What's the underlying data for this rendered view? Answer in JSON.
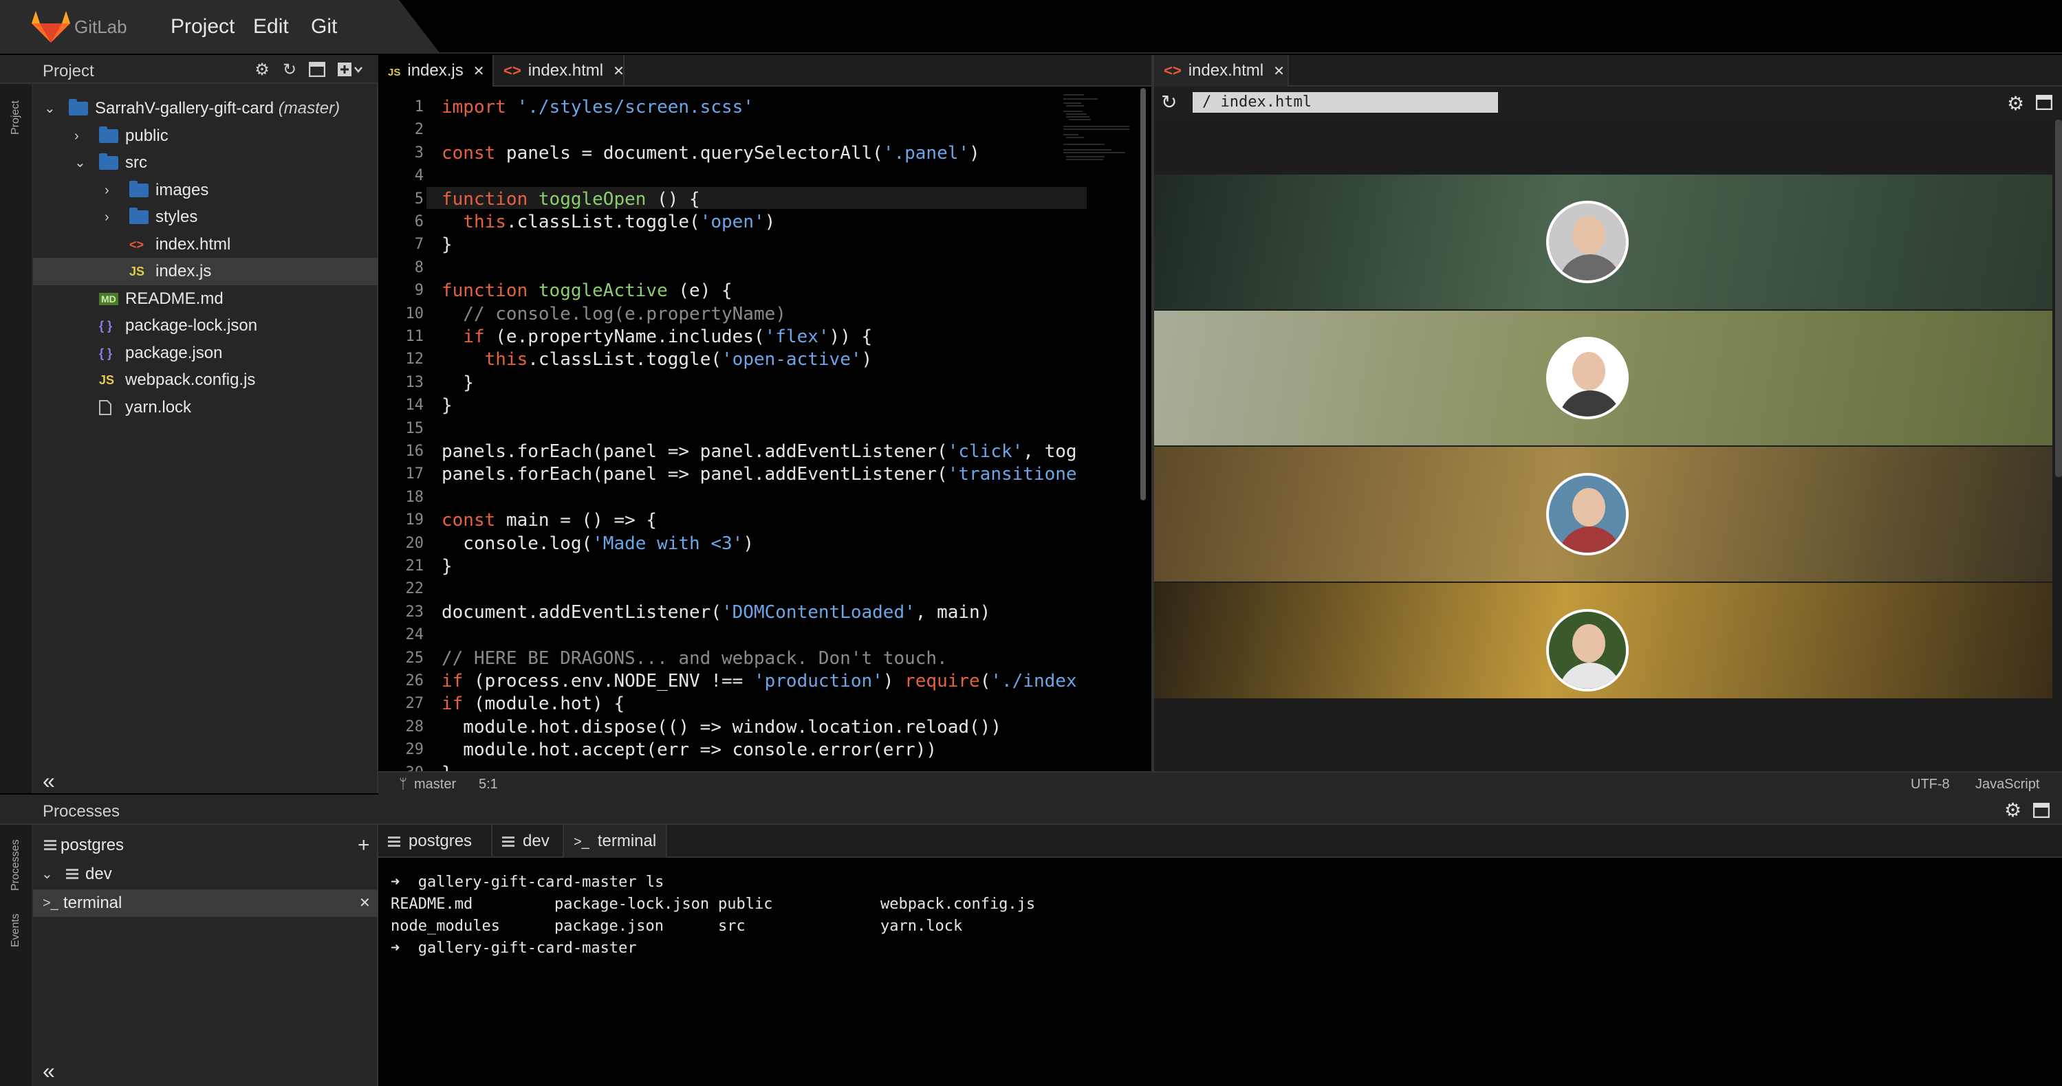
{
  "app": {
    "brand": "GitLab",
    "menu": [
      "Project",
      "Edit",
      "Git"
    ]
  },
  "project_panel": {
    "title": "Project"
  },
  "rail": {
    "project": "Project",
    "processes": "Processes",
    "events": "Events"
  },
  "tree": [
    {
      "label": "SarrahV-gallery-gift-card",
      "suffix": "(master)",
      "type": "folder",
      "open": true,
      "depth": 0
    },
    {
      "label": "public",
      "type": "folder",
      "open": false,
      "depth": 1
    },
    {
      "label": "src",
      "type": "folder",
      "open": true,
      "depth": 1
    },
    {
      "label": "images",
      "type": "folder",
      "open": false,
      "depth": 2
    },
    {
      "label": "styles",
      "type": "folder",
      "open": false,
      "depth": 2
    },
    {
      "label": "index.html",
      "type": "html",
      "depth": 2
    },
    {
      "label": "index.js",
      "type": "js",
      "depth": 2,
      "selected": true
    },
    {
      "label": "README.md",
      "type": "md",
      "depth": 1
    },
    {
      "label": "package-lock.json",
      "type": "json",
      "depth": 1
    },
    {
      "label": "package.json",
      "type": "json",
      "depth": 1
    },
    {
      "label": "webpack.config.js",
      "type": "js",
      "depth": 1
    },
    {
      "label": "yarn.lock",
      "type": "file",
      "depth": 1
    }
  ],
  "file_icons": {
    "js": "JS",
    "html": "<>",
    "md": "MD",
    "json": "{ }"
  },
  "editor_tabs": [
    {
      "label": "index.js",
      "icon": "js",
      "active": true
    },
    {
      "label": "index.html",
      "icon": "html",
      "active": false
    }
  ],
  "code_lines": [
    "import './styles/screen.scss'",
    "",
    "const panels = document.querySelectorAll('.panel')",
    "",
    "function toggleOpen () {",
    "  this.classList.toggle('open')",
    "}",
    "",
    "function toggleActive (e) {",
    "  // console.log(e.propertyName)",
    "  if (e.propertyName.includes('flex')) {",
    "    this.classList.toggle('open-active')",
    "  }",
    "}",
    "",
    "panels.forEach(panel => panel.addEventListener('click', tog",
    "panels.forEach(panel => panel.addEventListener('transitione",
    "",
    "const main = () => {",
    "  console.log('Made with <3')",
    "}",
    "",
    "document.addEventListener('DOMContentLoaded', main)",
    "",
    "// HERE BE DRAGONS... and webpack. Don't touch.",
    "if (process.env.NODE_ENV !== 'production') require('./index",
    "if (module.hot) {",
    "  module.hot.dispose(() => window.location.reload())",
    "  module.hot.accept(err => console.error(err))",
    "}"
  ],
  "status": {
    "branch": "master",
    "cursor": "5:1",
    "encoding": "UTF-8",
    "language": "JavaScript"
  },
  "preview": {
    "tab_label": "index.html",
    "url": "/ index.html",
    "panels": [
      {
        "colors": [
          "#1f2b22",
          "#4d6650",
          "#2c3b2f"
        ],
        "avatar_top": "#c9c9c9",
        "shirt": "#6a6a6a"
      },
      {
        "colors": [
          "#a8ad9a",
          "#8b9160",
          "#5f6a3c"
        ],
        "avatar_top": "#ffffff",
        "shirt": "#3c3c3c"
      },
      {
        "colors": [
          "#5d4a2a",
          "#a88a4a",
          "#3a3422"
        ],
        "avatar_top": "#5d8aa8",
        "shirt": "#a53a3a"
      },
      {
        "colors": [
          "#2d2414",
          "#c29a3c",
          "#3a2e18"
        ],
        "avatar_top": "#3a5a2c",
        "shirt": "#e6e6e6"
      }
    ]
  },
  "processes": {
    "title": "Processes",
    "items": [
      {
        "label": "postgres",
        "icon": "db"
      },
      {
        "label": "dev",
        "icon": "db",
        "chevron": true
      },
      {
        "label": "terminal",
        "icon": "terminal",
        "selected": true
      }
    ]
  },
  "terminal_tabs": [
    {
      "label": "postgres",
      "icon": "db"
    },
    {
      "label": "dev",
      "icon": "db"
    },
    {
      "label": "terminal",
      "icon": "terminal",
      "active": true
    }
  ],
  "terminal": {
    "prompt_symbol": "➜",
    "cmd1": "gallery-gift-card-master ls",
    "ls_col1": [
      "README.md",
      "node_modules"
    ],
    "ls_col2": [
      "package-lock.json",
      "package.json"
    ],
    "ls_col3": [
      "public",
      "src"
    ],
    "ls_col4": [
      "webpack.config.js",
      "yarn.lock"
    ],
    "cmd2": "gallery-gift-card-master"
  }
}
